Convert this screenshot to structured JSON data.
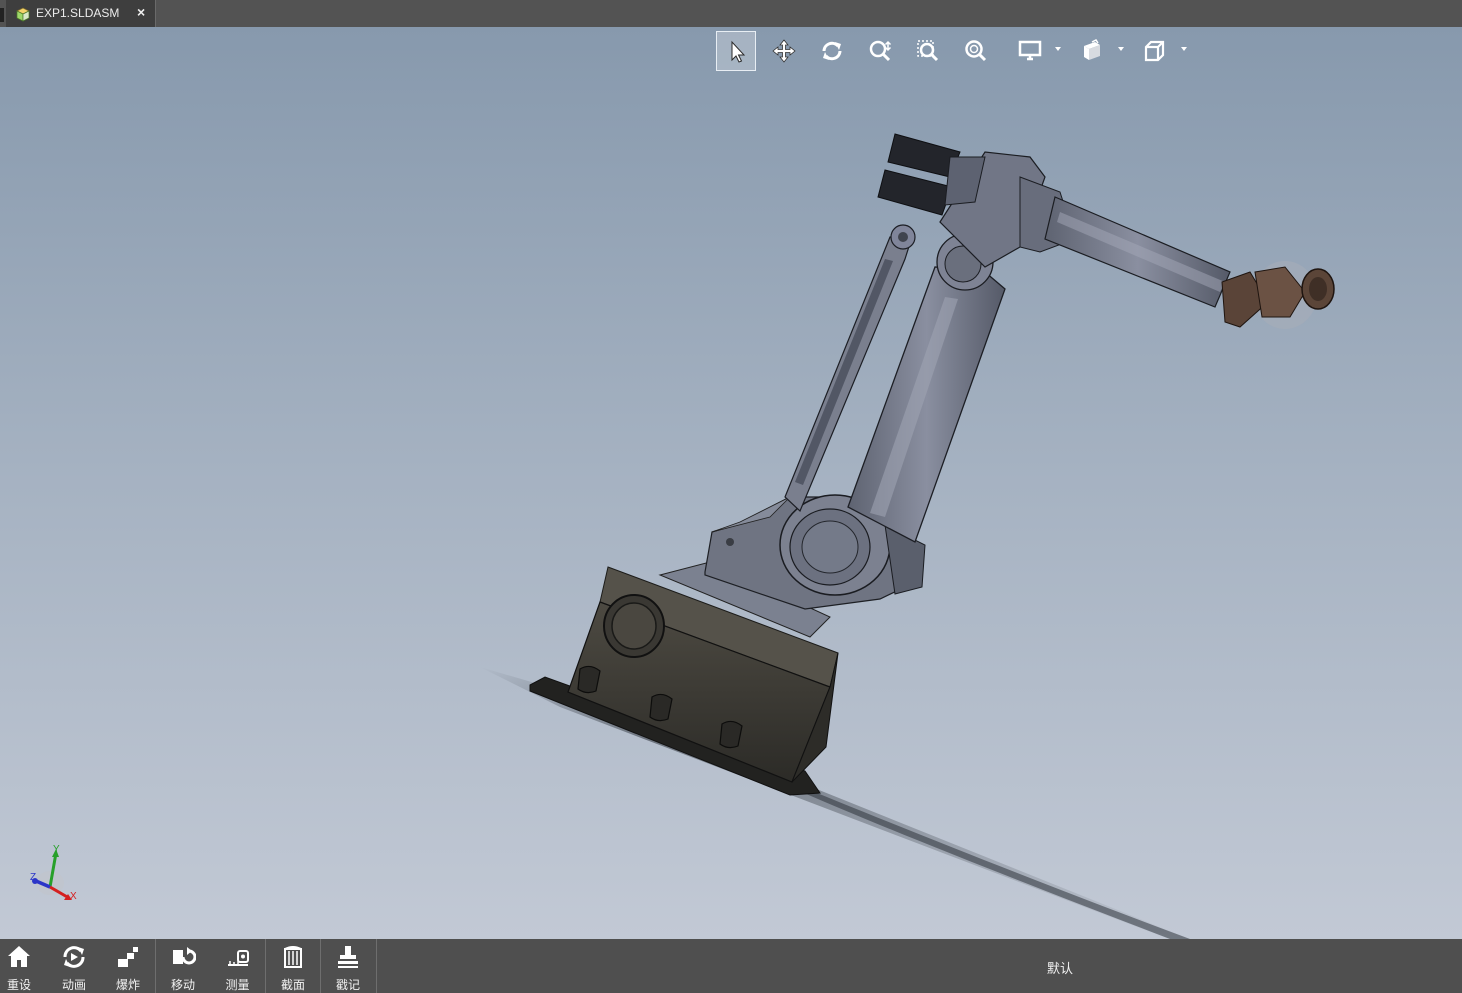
{
  "document_tab": {
    "title": "EXP1.SLDASM",
    "close_glyph": "×",
    "icon": "assembly-icon"
  },
  "view_toolbar": {
    "tools": [
      {
        "name": "select",
        "icon": "pointer-icon",
        "active": true
      },
      {
        "name": "pan",
        "icon": "pan-icon"
      },
      {
        "name": "rotate",
        "icon": "rotate-icon"
      },
      {
        "name": "zoom-in-out",
        "icon": "zoom-in-out-icon"
      },
      {
        "name": "zoom-to-area",
        "icon": "zoom-area-icon"
      },
      {
        "name": "zoom-to-fit",
        "icon": "zoom-fit-icon"
      },
      {
        "name": "display-style",
        "icon": "monitor-icon",
        "dropdown": true
      },
      {
        "name": "section-view",
        "icon": "section-view-icon",
        "dropdown": true
      },
      {
        "name": "view-orientation",
        "icon": "cube-view-icon",
        "dropdown": true
      }
    ]
  },
  "triad": {
    "x": "X",
    "y": "Y",
    "z": "Z",
    "x_color": "#d42020",
    "y_color": "#27a02a",
    "z_color": "#2b35c8"
  },
  "bottom_toolbar": {
    "items": [
      {
        "label": "重设",
        "icon": "home-icon"
      },
      {
        "label": "动画",
        "icon": "animation-icon"
      },
      {
        "label": "爆炸",
        "icon": "explode-icon"
      },
      {
        "label": "移动",
        "icon": "move-icon"
      },
      {
        "label": "测量",
        "icon": "measure-icon"
      },
      {
        "label": "截面",
        "icon": "section-icon"
      },
      {
        "label": "戳记",
        "icon": "stamp-icon"
      }
    ],
    "configuration": "默认"
  }
}
